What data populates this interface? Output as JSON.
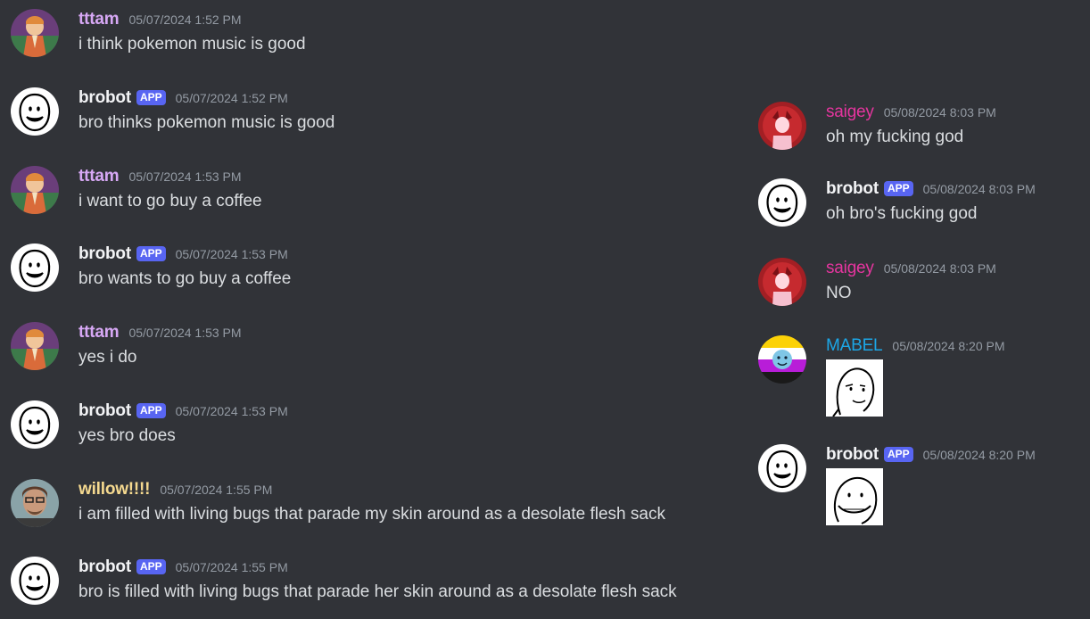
{
  "tag_label": "APP",
  "users": {
    "tttam": {
      "name": "tttam",
      "color": "#d7a8f5"
    },
    "brobot": {
      "name": "brobot",
      "color": "#f2f3f5"
    },
    "willow": {
      "name": "willow!!!!",
      "color": "#f5d98f"
    },
    "saigey": {
      "name": "saigey",
      "color": "#e6359f"
    },
    "mabel": {
      "name": "MABEL",
      "color": "#1ca7e7"
    }
  },
  "left_messages": [
    {
      "user": "tttam",
      "timestamp": "05/07/2024 1:52 PM",
      "text": "i think pokemon music is good"
    },
    {
      "user": "brobot",
      "timestamp": "05/07/2024 1:52 PM",
      "text": "bro thinks pokemon music is good"
    },
    {
      "user": "tttam",
      "timestamp": "05/07/2024 1:53 PM",
      "text": "i want to go buy a coffee"
    },
    {
      "user": "brobot",
      "timestamp": "05/07/2024 1:53 PM",
      "text": "bro wants to go buy a coffee"
    },
    {
      "user": "tttam",
      "timestamp": "05/07/2024 1:53 PM",
      "text": "yes i do"
    },
    {
      "user": "brobot",
      "timestamp": "05/07/2024 1:53 PM",
      "text": "yes bro does"
    },
    {
      "user": "willow",
      "timestamp": "05/07/2024 1:55 PM",
      "text": "i am filled with living bugs that parade my skin around as a desolate flesh sack"
    },
    {
      "user": "brobot",
      "timestamp": "05/07/2024 1:55 PM",
      "text": "bro is filled with living bugs that parade her skin around as a desolate flesh sack"
    }
  ],
  "right_messages": [
    {
      "user": "saigey",
      "timestamp": "05/08/2024 8:03 PM",
      "text": "oh my fucking god"
    },
    {
      "user": "brobot",
      "timestamp": "05/08/2024 8:03 PM",
      "text": "oh bro's fucking god"
    },
    {
      "user": "saigey",
      "timestamp": "05/08/2024 8:03 PM",
      "text": "NO"
    },
    {
      "user": "mabel",
      "timestamp": "05/08/2024 8:20 PM",
      "text": "",
      "image": "brobot-face-sketch"
    },
    {
      "user": "brobot",
      "timestamp": "05/08/2024 8:20 PM",
      "text": "",
      "image": "brobot-face-sketch-smile"
    }
  ]
}
